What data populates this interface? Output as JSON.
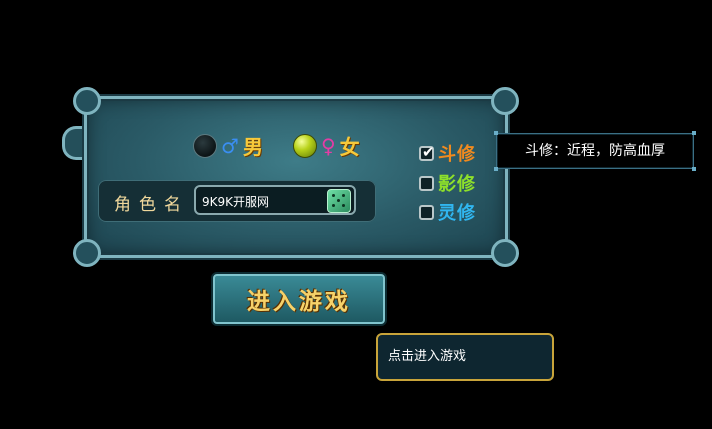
{
  "gender": {
    "male_symbol": "♂",
    "male_label": "男",
    "female_symbol": "♀",
    "female_label": "女",
    "selected": "female"
  },
  "name": {
    "label": "角色名",
    "value": "9K9K开服网"
  },
  "classes": [
    {
      "label": "斗修",
      "checked": true,
      "color": "#f08a1e"
    },
    {
      "label": "影修",
      "checked": false,
      "color": "#8ee02a"
    },
    {
      "label": "灵修",
      "checked": false,
      "color": "#30b6f0"
    }
  ],
  "class_tooltip": "斗修：近程，防高血厚",
  "enter_button": "进入游戏",
  "enter_tooltip": "点击进入游戏",
  "icons": [
    "male-orb-icon",
    "female-orb-icon",
    "dice-icon",
    "checkmark-icon"
  ]
}
